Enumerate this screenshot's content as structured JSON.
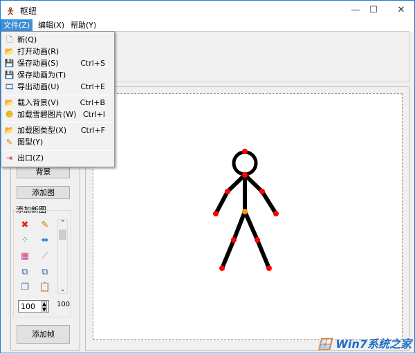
{
  "window": {
    "title": "枢纽",
    "icon": "stick-figure-icon",
    "minimize": "—",
    "maximize": "☐",
    "close": "✕"
  },
  "menubar": [
    {
      "label": "文件(Z)"
    },
    {
      "label": "编辑(X)"
    },
    {
      "label": "帮助(Y)"
    }
  ],
  "file_menu": [
    {
      "label": "新(Q)",
      "shortcut": "",
      "icon": "new-file-icon"
    },
    {
      "label": "打开动画(R)",
      "shortcut": "",
      "icon": "open-icon"
    },
    {
      "label": "保存动画(S)",
      "shortcut": "Ctrl+S",
      "icon": "save-icon"
    },
    {
      "label": "保存动画为(T)",
      "shortcut": "",
      "icon": "save-as-icon"
    },
    {
      "label": "导出动画(U)",
      "shortcut": "Ctrl+E",
      "icon": "film-icon"
    },
    {
      "label": "载入背景(V)",
      "shortcut": "Ctrl+B",
      "icon": "folder-icon"
    },
    {
      "label": "加载雪碧图片(W)",
      "shortcut": "Ctrl+I",
      "icon": "smiley-icon"
    },
    {
      "label": "加载图类型(X)",
      "shortcut": "Ctrl+F",
      "icon": "load-figure-icon"
    },
    {
      "label": "图型(Y)",
      "shortcut": "",
      "icon": "pencil-icon"
    },
    {
      "label": "出口(Z)",
      "shortcut": "",
      "icon": "exit-icon"
    }
  ],
  "left_panel": {
    "background_button": "背景",
    "add_figure_button": "添加图",
    "group_label": "添加新图",
    "size_value": "100",
    "size_readout": "100",
    "add_frame_button": "添加帧"
  },
  "colors": {
    "accent": "#3d8fd8",
    "joint": "#ff0000",
    "center_joint": "#ff9900",
    "limb": "#000000"
  },
  "watermark": "Win7系统之家 www.Winwin7.com"
}
